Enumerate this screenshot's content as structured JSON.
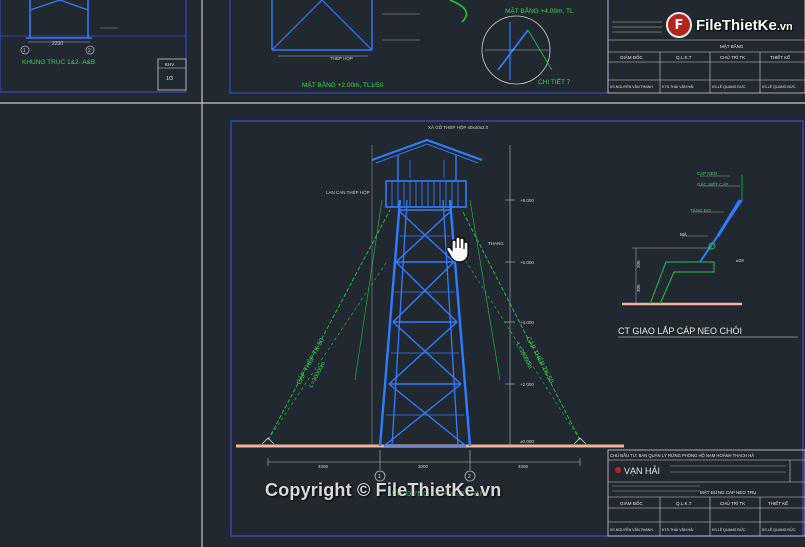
{
  "drawing": {
    "top_left_title": "KHUNG TRỤC 1&2- A&B",
    "top_left_dim": "2200",
    "top_left_axis_1": "1",
    "top_left_axis_2": "2",
    "top_left_sheet_label": "KHV",
    "top_left_sheet_num": "1/3",
    "top_mid_title": "MẶT BẰNG +2.00m, TL1/50",
    "top_mid_title2": "MẶT BẰNG +4.00m, TL",
    "top_mid_label": "THÉP HỘP",
    "top_mid_detail": "CHI TIẾT 7",
    "main_title": "MẶT ĐỨNG CÁP NEO TRỤ",
    "cable_left": "CÁP THÉP TK-50",
    "cable_left2": "L=30000m",
    "cable_right": "CÁP THÉP TK-50",
    "cable_right2": "L=30000m",
    "roof_label": "XÀ GỒ THÉP HỘP 40x40x2.0",
    "label_platform": "LAN CAN THÉP HỘP",
    "label_stair": "THANG",
    "elev_1": "+8.000",
    "elev_2": "+6.000",
    "elev_3": "+4.000",
    "elev_4": "+2.000",
    "elev_5": "±0.000",
    "dim_left": "4000",
    "dim_mid": "3000",
    "dim_right": "4000",
    "axis_1": "1",
    "axis_2": "2",
    "detail_title": "CT GIAO LẮP CÁP NEO CHÓI",
    "detail_l1": "CÁP NEO",
    "detail_l2": "GÁC SIẾT CÁP",
    "detail_l3": "TĂNG ĐƠ",
    "detail_l4": "MÃ",
    "detail_dim1": "200",
    "detail_dim2": "300",
    "detail_dim3": "ø28",
    "tb_header": "CHỦ ĐẦU TƯ: BAN QUẢN LÝ RỪNG PHÒNG HỘ NAM HOÀNH THẠCH HÃ",
    "tb_company": "VẠN HẢI",
    "tb_sheet_title": "MẶT BẰNG",
    "tb_sheet_title2": "MẶT ĐỨNG CÁP NEO TRỤ",
    "tb_col1": "GIÁM ĐỐC",
    "tb_col2": "Q.L.K.T",
    "tb_col3": "CHỦ TRÌ TK",
    "tb_col4": "THIẾT KẾ",
    "tb_name1": "KS.NGUYỄN VĂN THANH",
    "tb_name2": "KTS.THÁI VĂN HẢI",
    "tb_name3": "KS.LÊ QUANG ĐỨC",
    "tb_name4": "KS.LÊ QUANG ĐỨC"
  },
  "branding": {
    "logo_badge": "F",
    "logo_name": "FileThietKe",
    "logo_domain": ".vn",
    "watermark": "Copyright © FileThietKe.vn"
  },
  "colors": {
    "background": "#212830",
    "frame_blue": "#3a4fd6",
    "tower_blue": "#2f7dff",
    "cable_green": "#27c24a",
    "ground": "#f2b39a",
    "text_white": "#e6e6e6",
    "text_green": "#3ad35a"
  }
}
